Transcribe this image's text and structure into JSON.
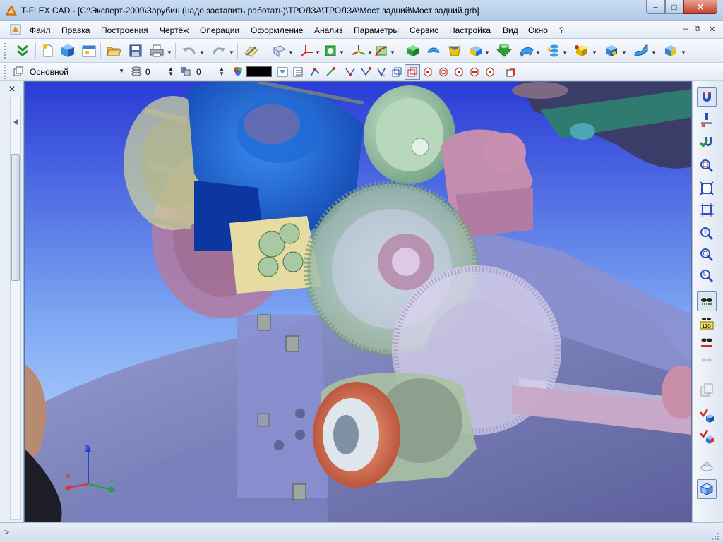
{
  "window": {
    "title": "T-FLEX CAD - [C:\\Эксперт-2009\\Зарубин (надо заставить работать)\\ТРОЛЗА\\ТРОЛЗА\\Мост задний\\Мост задний.grb]",
    "minimize_glyph": "–",
    "maximize_glyph": "□",
    "close_glyph": "✕"
  },
  "menu": {
    "items": [
      "Файл",
      "Правка",
      "Построения",
      "Чертёж",
      "Операции",
      "Оформление",
      "Анализ",
      "Параметры",
      "Сервис",
      "Настройка",
      "Вид",
      "Окно",
      "?"
    ],
    "mdi_minimize": "–",
    "mdi_restore": "⧉",
    "mdi_close": "✕"
  },
  "toolbar2": {
    "layer_value": "Основной",
    "level_value": "0",
    "priority_value": "0",
    "color_value": "#000000"
  },
  "left_panel": {
    "close_glyph": "✕"
  },
  "statusbar": {
    "prompt_glyph": ">"
  },
  "axes": {
    "x_label": "X",
    "y_label": "Y",
    "z_label": "Z"
  },
  "icons": {
    "app": "tflex-logo-icon",
    "toolbar1": [
      "double-chevron-icon",
      "new-document-icon",
      "new-3d-model-icon",
      "new-drawing-icon",
      "open-folder-icon",
      "save-icon",
      "print-icon",
      "undo-icon",
      "redo-icon",
      "sketch-plane-icon",
      "workplane-icon",
      "lcs-icon",
      "profile-icon",
      "3d-node-icon",
      "3d-path-icon",
      "extrude-icon",
      "revolve-icon",
      "loft-icon",
      "sweep-icon",
      "boolean-icon",
      "smooth-icon",
      "array-icon",
      "body-icon",
      "shell-icon",
      "surface-icon",
      "bend-icon"
    ],
    "right_toolbar": [
      "snap-magnet-icon",
      "snap-point-icon",
      "snap-check-icon",
      "zoom-window-icon",
      "zoom-fit-icon",
      "zoom-all-icon",
      "zoom-in-icon",
      "zoom-out-icon",
      "zoom-prev-icon",
      "show-hidden-icon",
      "numbering-icon",
      "toggle-visibility-icon",
      "show-all-icon",
      "copy-icon",
      "check-body-icon",
      "check-model-icon",
      "section-icon",
      "3d-view-icon"
    ]
  },
  "colors": {
    "viewport_bg_top": "#2a3cd6",
    "viewport_bg_bottom": "#cfe7ff",
    "axis_x": "#e0302a",
    "axis_y": "#22a23a",
    "axis_z": "#2b3fd8"
  }
}
